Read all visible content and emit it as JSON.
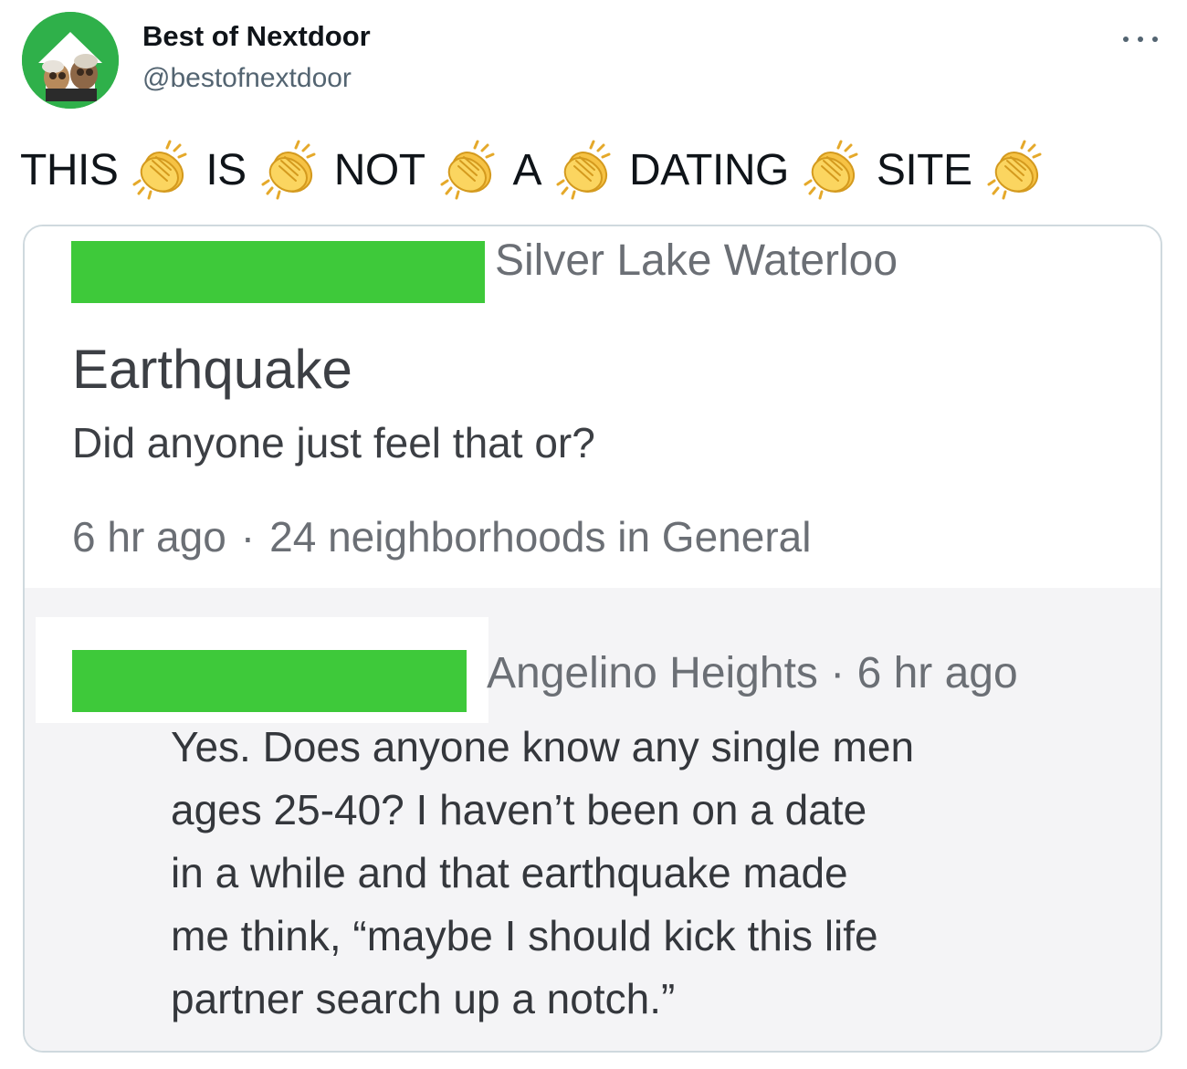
{
  "tweet": {
    "author_name": "Best of Nextdoor",
    "author_handle": "@bestofnextdoor",
    "avatar_icon": "nextdoor-house-avatar",
    "more_icon": "more-options-icon",
    "text_words": [
      "THIS",
      "IS",
      "NOT",
      "A",
      "DATING",
      "SITE"
    ],
    "emoji": "clapping-hands-emoji"
  },
  "screenshot": {
    "post": {
      "neighborhood": "Silver Lake Waterloo",
      "title": "Earthquake",
      "body": "Did anyone just feel that or?",
      "time": "6 hr ago",
      "separator": "·",
      "reach": "24 neighborhoods in General"
    },
    "reply": {
      "meta": "Angelino Heights · 6 hr ago",
      "lines": [
        "Yes. Does anyone know any single men",
        "ages 25-40? I haven’t been on a date",
        "in a while and that earthquake made",
        "me think, “maybe I should kick this life",
        "partner search up a notch.”"
      ]
    },
    "redaction_color": "#3ec93a"
  },
  "colors": {
    "accent_green": "#2fb04a",
    "text_primary": "#0f1419",
    "text_secondary": "#536471",
    "card_border": "#cfd9de",
    "reply_background": "#f4f4f6"
  }
}
